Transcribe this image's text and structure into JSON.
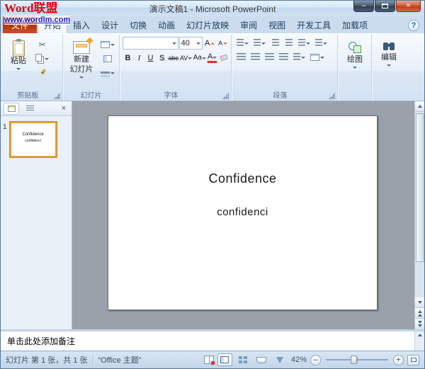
{
  "watermark": {
    "title": "Word联盟",
    "url": "www.wordlm.com"
  },
  "window": {
    "title": "演示文稿1 - Microsoft PowerPoint"
  },
  "icons": {
    "scissors": "✂",
    "help": "?",
    "close": "×",
    "minimize": "–",
    "panel_close": "×"
  },
  "tabs": {
    "file": "文件",
    "items": [
      "开始",
      "插入",
      "设计",
      "切换",
      "动画",
      "幻灯片放映",
      "审阅",
      "视图",
      "开发工具",
      "加载项"
    ],
    "selected": "开始"
  },
  "ribbon": {
    "clipboard": {
      "paste": "粘贴",
      "label": "剪贴板"
    },
    "slides": {
      "new1": "新建",
      "new2": "幻灯片",
      "label": "幻灯片"
    },
    "font": {
      "name": "",
      "size": "40",
      "bold": "B",
      "italic": "I",
      "underline": "U",
      "shadow": "S",
      "strike": "abc",
      "spacing": "AV",
      "case": "Aa",
      "color": "A",
      "grow": "A",
      "shrink": "A",
      "label": "字体"
    },
    "paragraph": {
      "label": "段落"
    },
    "drawing": {
      "label": "绘图"
    },
    "editing": {
      "label": "编辑"
    }
  },
  "slides_panel": {
    "slide_number": "1"
  },
  "slide": {
    "line1": "Confidence",
    "line2": "confidenci"
  },
  "notes": {
    "placeholder": "单击此处添加备注"
  },
  "statusbar": {
    "slide_info": "幻灯片 第 1 张，共 1 张",
    "theme": "“Office 主题”",
    "zoom": "42%",
    "zoom_out": "–",
    "zoom_in": "+"
  },
  "colors": {
    "file_tab": "#c63f17",
    "selected_thumbnail_border": "#e8a33d",
    "canvas_background": "#9aa1ab",
    "chrome_blue": "#cadcee"
  }
}
